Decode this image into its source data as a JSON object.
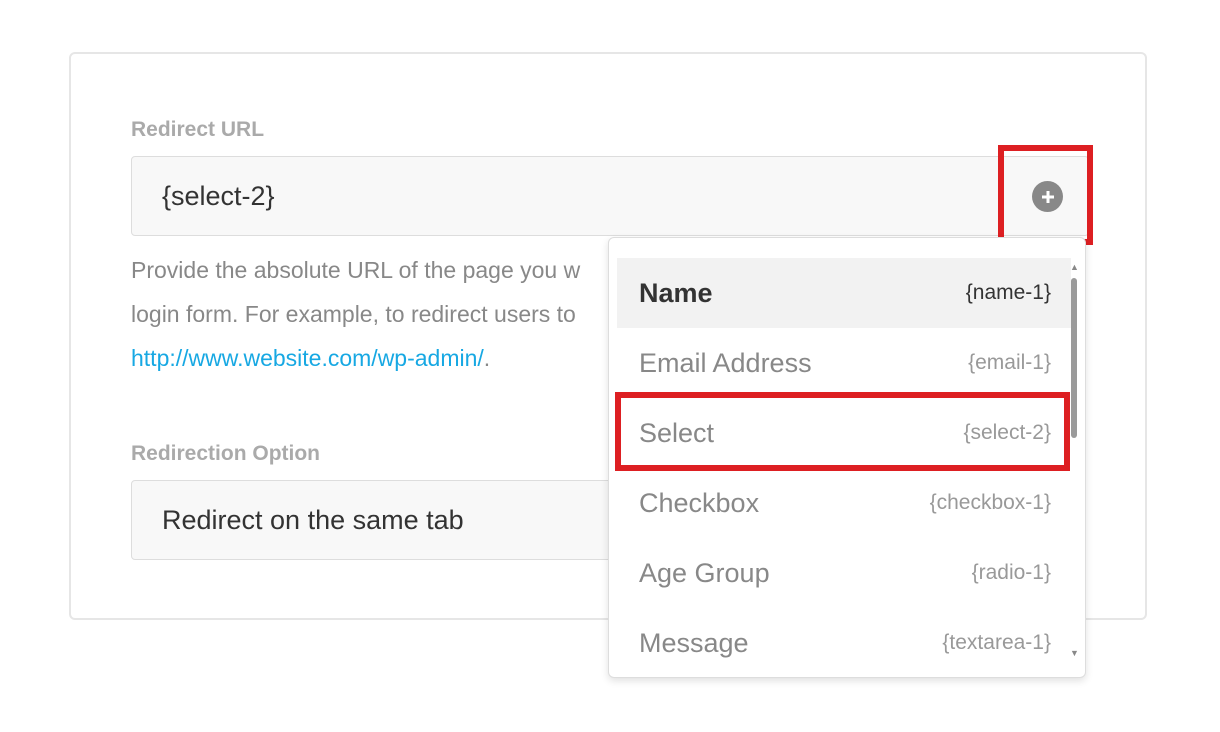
{
  "redirect_url": {
    "label": "Redirect URL",
    "value": "{select-2}",
    "description_prefix": "Provide the absolute URL of the page you w",
    "description_line2": "login form. For example, to redirect users to",
    "description_link": "http://www.website.com/wp-admin/",
    "description_suffix": ".",
    "insert_icon": "plus-circle-icon"
  },
  "redirection_option": {
    "label": "Redirection Option",
    "value": "Redirect on the same tab"
  },
  "dropdown": {
    "items": [
      {
        "name": "Name",
        "tag": "{name-1}",
        "active": true
      },
      {
        "name": "Email Address",
        "tag": "{email-1}"
      },
      {
        "name": "Select",
        "tag": "{select-2}",
        "highlighted": true
      },
      {
        "name": "Checkbox",
        "tag": "{checkbox-1}"
      },
      {
        "name": "Age Group",
        "tag": "{radio-1}"
      },
      {
        "name": "Message",
        "tag": "{textarea-1}"
      }
    ]
  },
  "colors": {
    "highlight": "#dd1f22",
    "link": "#17a8e3"
  }
}
